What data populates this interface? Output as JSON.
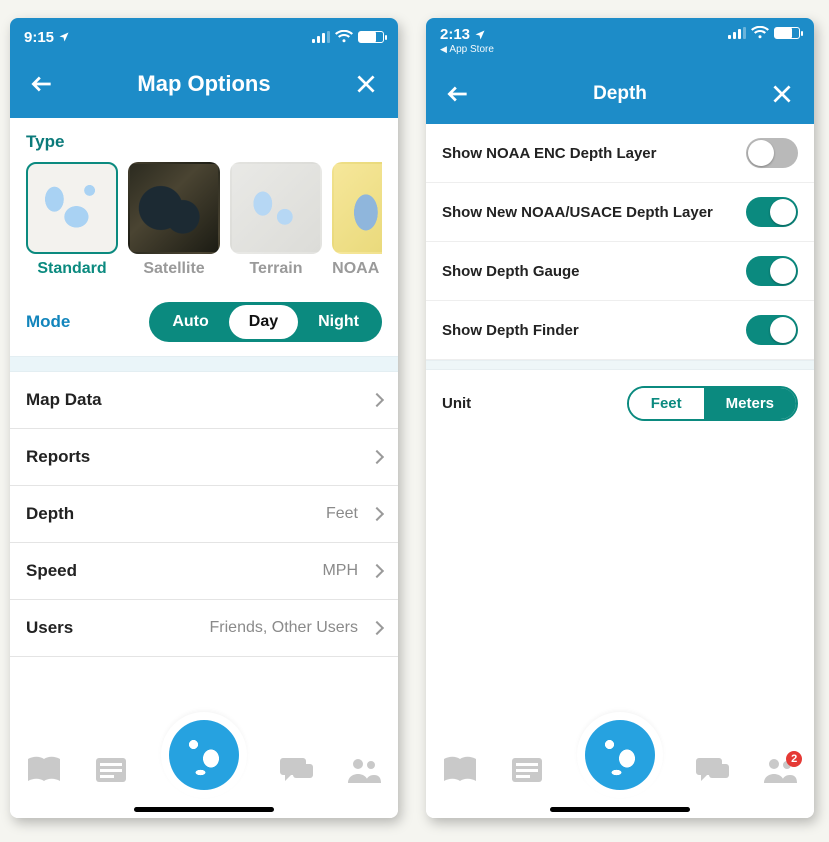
{
  "left": {
    "status": {
      "time": "9:15"
    },
    "header": {
      "title": "Map Options"
    },
    "type_label": "Type",
    "types": [
      {
        "label": "Standard",
        "selected": true
      },
      {
        "label": "Satellite",
        "selected": false
      },
      {
        "label": "Terrain",
        "selected": false
      },
      {
        "label": "NOAA E",
        "selected": false
      }
    ],
    "mode_label": "Mode",
    "modes": {
      "auto": "Auto",
      "day": "Day",
      "night": "Night",
      "active": "Day"
    },
    "rows": {
      "map_data": {
        "label": "Map Data"
      },
      "reports": {
        "label": "Reports"
      },
      "depth": {
        "label": "Depth",
        "value": "Feet"
      },
      "speed": {
        "label": "Speed",
        "value": "MPH"
      },
      "users": {
        "label": "Users",
        "value": "Friends, Other Users"
      }
    }
  },
  "right": {
    "status": {
      "time": "2:13",
      "back_app": "App Store"
    },
    "header": {
      "title": "Depth"
    },
    "toggles": [
      {
        "label": "Show NOAA ENC Depth Layer",
        "on": false
      },
      {
        "label": "Show New NOAA/USACE Depth Layer",
        "on": true
      },
      {
        "label": "Show Depth Gauge",
        "on": true
      },
      {
        "label": "Show Depth Finder",
        "on": true
      }
    ],
    "unit": {
      "label": "Unit",
      "feet": "Feet",
      "meters": "Meters",
      "active": "Meters"
    },
    "nav_badge": "2"
  }
}
